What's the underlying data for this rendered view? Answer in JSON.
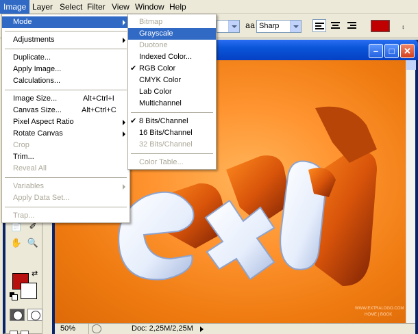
{
  "menubar": {
    "items": [
      {
        "label": "Image",
        "active": true
      },
      {
        "label": "Layer"
      },
      {
        "label": "Select"
      },
      {
        "label": "Filter"
      },
      {
        "label": "View"
      },
      {
        "label": "Window"
      },
      {
        "label": "Help"
      }
    ]
  },
  "options_bar": {
    "antialias_icon": "aa",
    "antialias_value": "Sharp",
    "text_color": "#c00000"
  },
  "image_menu": {
    "groups": [
      [
        {
          "label": "Mode",
          "submenu": true,
          "highlighted": true
        }
      ],
      [
        {
          "label": "Adjustments",
          "submenu": true
        }
      ],
      [
        {
          "label": "Duplicate..."
        },
        {
          "label": "Apply Image..."
        },
        {
          "label": "Calculations..."
        }
      ],
      [
        {
          "label": "Image Size...",
          "shortcut": "Alt+Ctrl+I"
        },
        {
          "label": "Canvas Size...",
          "shortcut": "Alt+Ctrl+C"
        },
        {
          "label": "Pixel Aspect Ratio",
          "submenu": true
        },
        {
          "label": "Rotate Canvas",
          "submenu": true
        },
        {
          "label": "Crop",
          "disabled": true
        },
        {
          "label": "Trim..."
        },
        {
          "label": "Reveal All",
          "disabled": true
        }
      ],
      [
        {
          "label": "Variables",
          "submenu": true,
          "disabled": true
        },
        {
          "label": "Apply Data Set...",
          "disabled": true
        }
      ],
      [
        {
          "label": "Trap...",
          "disabled": true
        }
      ]
    ]
  },
  "mode_submenu": {
    "groups": [
      [
        {
          "label": "Bitmap",
          "disabled": true
        },
        {
          "label": "Grayscale",
          "highlighted": true
        },
        {
          "label": "Duotone",
          "disabled": true
        },
        {
          "label": "Indexed Color..."
        },
        {
          "label": "RGB Color",
          "checked": true
        },
        {
          "label": "CMYK Color"
        },
        {
          "label": "Lab Color"
        },
        {
          "label": "Multichannel"
        }
      ],
      [
        {
          "label": "8 Bits/Channel",
          "checked": true
        },
        {
          "label": "16 Bits/Channel"
        },
        {
          "label": "32 Bits/Channel",
          "disabled": true
        }
      ],
      [
        {
          "label": "Color Table...",
          "disabled": true
        }
      ]
    ]
  },
  "toolbox": {
    "foreground_color": "#b80f0f",
    "background_color": "#ffffff"
  },
  "document": {
    "zoom": "50%",
    "doc_info": "Doc: 2,25M/2,25M",
    "watermark_line1": "WWW.EXTRALOGO.COM",
    "watermark_line2": "HOME | BOOK"
  }
}
